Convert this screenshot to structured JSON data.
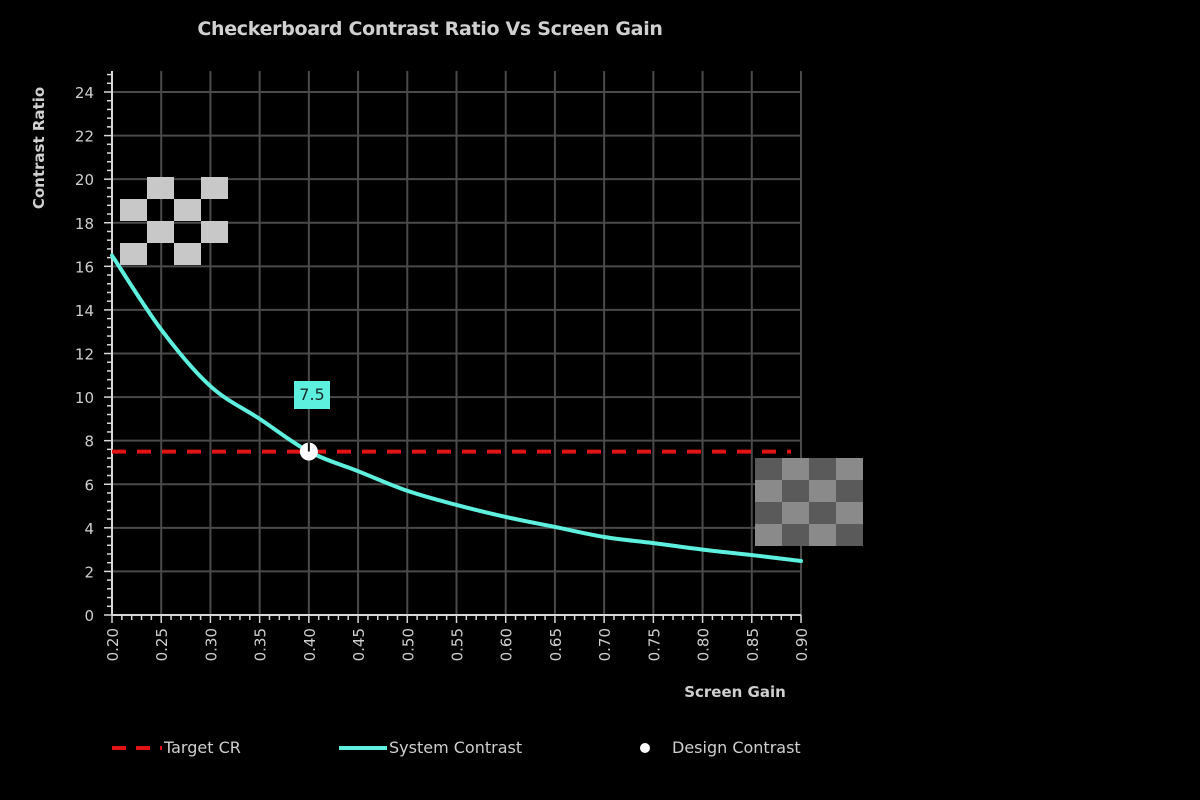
{
  "chart_data": {
    "type": "line",
    "title": "Checkerboard Contrast Ratio Vs Screen Gain",
    "xlabel": "Screen Gain",
    "ylabel": "Contrast Ratio",
    "xlim": [
      0.2,
      0.9
    ],
    "ylim": [
      0,
      25
    ],
    "x_ticks": [
      "0.20",
      "0.25",
      "0.30",
      "0.35",
      "0.40",
      "0.45",
      "0.50",
      "0.55",
      "0.60",
      "0.65",
      "0.70",
      "0.75",
      "0.80",
      "0.85",
      "0.90"
    ],
    "y_ticks": [
      "0",
      "2",
      "4",
      "6",
      "8",
      "10",
      "12",
      "14",
      "16",
      "18",
      "20",
      "22",
      "24"
    ],
    "grid": true,
    "legend_position": "bottom",
    "series": [
      {
        "name": "System Contrast",
        "type": "line",
        "color": "#5ef0df",
        "x": [
          0.2,
          0.25,
          0.3,
          0.35,
          0.4,
          0.45,
          0.5,
          0.55,
          0.6,
          0.65,
          0.7,
          0.75,
          0.8,
          0.85,
          0.9
        ],
        "y": [
          16.5,
          13.1,
          10.5,
          9.0,
          7.5,
          6.6,
          5.7,
          5.05,
          4.5,
          4.04,
          3.58,
          3.3,
          3.0,
          2.75,
          2.48
        ]
      },
      {
        "name": "Target CR",
        "type": "hline",
        "style": "dashed",
        "color": "#e01414",
        "y": 7.5
      },
      {
        "name": "Design Contrast",
        "type": "scatter",
        "color": "#ffffff",
        "x": [
          0.4
        ],
        "y": [
          7.5
        ]
      }
    ],
    "annotations": [
      {
        "text": "7.5",
        "x": 0.4,
        "y": 7.5,
        "background": "#5ef0df"
      }
    ]
  },
  "legend": {
    "items": [
      {
        "label": "Target CR"
      },
      {
        "label": "System Contrast"
      },
      {
        "label": "Design Contrast"
      }
    ]
  },
  "decorations": {
    "high_contrast_checker": {
      "light": "#c8c8c8",
      "dark": "#000000"
    },
    "low_contrast_checker": {
      "light": "#8a8a8a",
      "dark": "#5a5a5a"
    }
  }
}
